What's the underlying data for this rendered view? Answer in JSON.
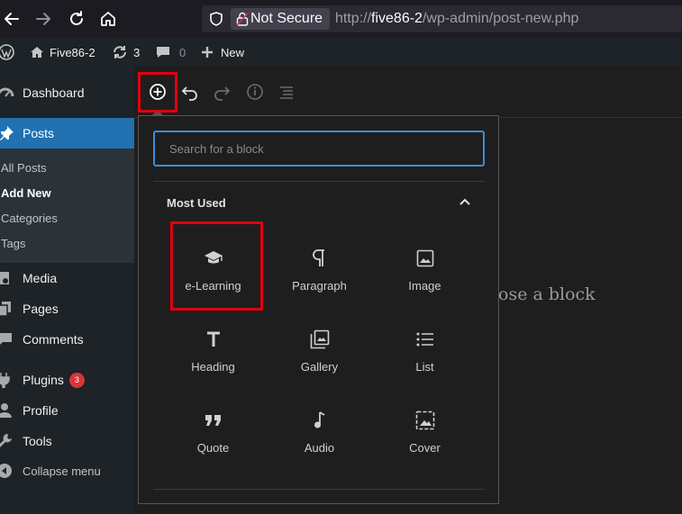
{
  "browser": {
    "not_secure_label": "Not Secure",
    "url_prefix": "http://",
    "url_host": "five86-2",
    "url_path": "/wp-admin/post-new.php"
  },
  "admin_bar": {
    "site_name": "Five86-2",
    "updates_count": "3",
    "comments_count": "0",
    "new_label": "New"
  },
  "sidebar": {
    "dashboard": "Dashboard",
    "posts": "Posts",
    "submenu": [
      "All Posts",
      "Add New",
      "Categories",
      "Tags"
    ],
    "media": "Media",
    "pages": "Pages",
    "comments": "Comments",
    "plugins": "Plugins",
    "plugins_badge": "3",
    "profile": "Profile",
    "tools": "Tools",
    "collapse": "Collapse menu"
  },
  "editor": {
    "canvas_placeholder": "ose a block"
  },
  "inserter": {
    "search_placeholder": "Search for a block",
    "section_title": "Most Used",
    "blocks": [
      {
        "label": "e-Learning",
        "icon": "mortarboard-icon"
      },
      {
        "label": "Paragraph",
        "icon": "pilcrow-icon"
      },
      {
        "label": "Image",
        "icon": "image-icon"
      },
      {
        "label": "Heading",
        "icon": "heading-icon"
      },
      {
        "label": "Gallery",
        "icon": "gallery-icon"
      },
      {
        "label": "List",
        "icon": "list-icon"
      },
      {
        "label": "Quote",
        "icon": "quote-icon"
      },
      {
        "label": "Audio",
        "icon": "audio-icon"
      },
      {
        "label": "Cover",
        "icon": "cover-icon"
      }
    ]
  },
  "colors": {
    "highlight": "#e0000d",
    "wp_blue": "#2271b1",
    "focus_border": "#3a8fd8"
  }
}
